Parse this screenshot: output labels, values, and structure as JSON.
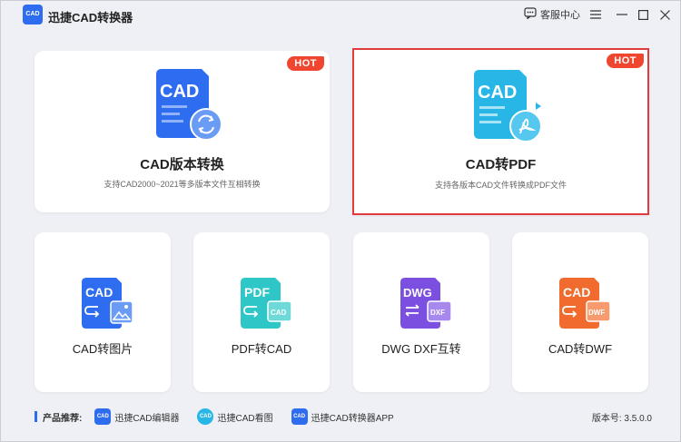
{
  "app": {
    "title": "迅捷CAD转换器",
    "logo_text": "CAD"
  },
  "titlebar": {
    "service_label": "客服中心"
  },
  "cards_top": [
    {
      "title": "CAD版本转换",
      "desc": "支持CAD2000~2021等多版本文件互相转换",
      "badge": "HOT",
      "icon_text": "CAD"
    },
    {
      "title": "CAD转PDF",
      "desc": "支持各版本CAD文件转换成PDF文件",
      "badge": "HOT",
      "icon_text": "CAD"
    }
  ],
  "cards_bottom": [
    {
      "title": "CAD转图片",
      "icon_text": "CAD"
    },
    {
      "title": "PDF转CAD",
      "icon_text": "PDF",
      "sub_text": "CAD"
    },
    {
      "title": "DWG DXF互转",
      "icon_text": "DWG",
      "sub_text": "DXF"
    },
    {
      "title": "CAD转DWF",
      "icon_text": "CAD",
      "sub_text": "DWF"
    }
  ],
  "footer": {
    "recommend_label": "产品推荐:",
    "items": [
      {
        "label": "迅捷CAD编辑器",
        "icon_text": "CAD"
      },
      {
        "label": "迅捷CAD看图",
        "icon_text": "CAD"
      },
      {
        "label": "迅捷CAD转换器APP",
        "icon_text": "CAD"
      }
    ],
    "version": "版本号: 3.5.0.0"
  },
  "colors": {
    "accent": "#2f6df0",
    "hot": "#f0452e",
    "selected_border": "#e23b3b",
    "pdf_teal": "#2fc6c8",
    "dwg_purple": "#7b4fe0",
    "dwf_orange": "#f26b2e"
  }
}
